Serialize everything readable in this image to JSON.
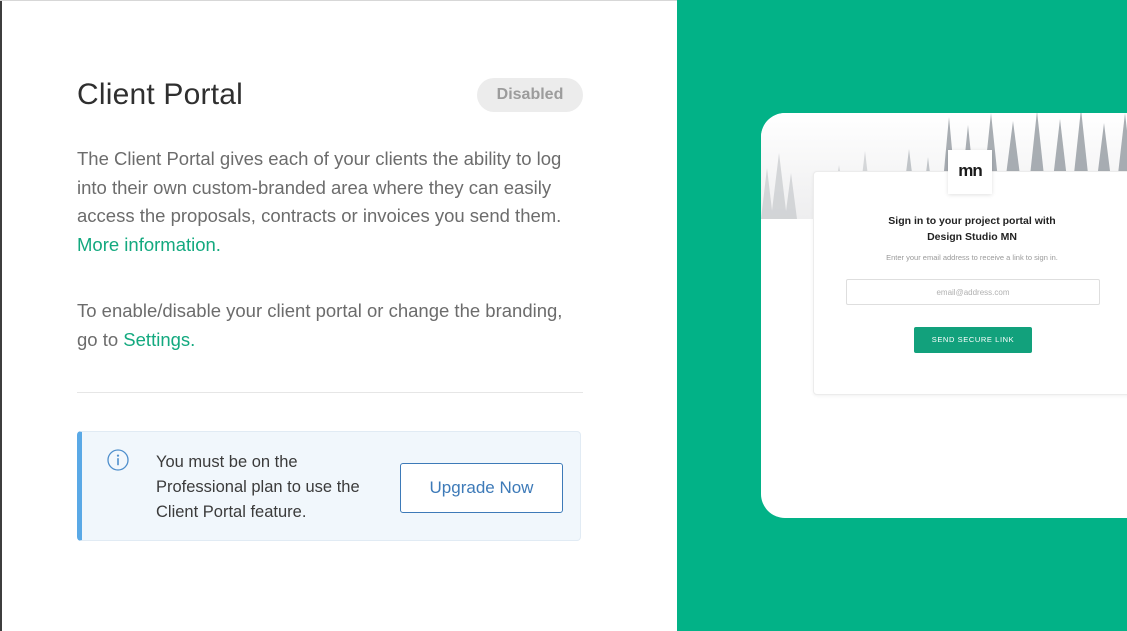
{
  "header": {
    "title": "Client Portal",
    "status_badge": "Disabled"
  },
  "description": {
    "text": "The Client Portal gives each of your clients the ability to log into their own custom-branded area where they can easily access the proposals, contracts or invoices you send them.",
    "more_link": "More information."
  },
  "settings_note": {
    "text": "To enable/disable your client portal or change the branding, go to",
    "settings_link": "Settings."
  },
  "notice": {
    "icon": "info-icon",
    "text": "You must be on the Professional plan to use the Client Portal feature.",
    "upgrade_label": "Upgrade Now"
  },
  "preview": {
    "logo": "mn",
    "signin_title_line1": "Sign in to your project portal with",
    "signin_title_line2": "Design Studio MN",
    "signin_subtitle": "Enter your email address to receive a link to sign in.",
    "email_placeholder": "email@address.com",
    "send_button": "SEND SECURE LINK"
  },
  "colors": {
    "accent_green": "#02b287",
    "link_green": "#13a97f",
    "upgrade_blue": "#3d7ab8",
    "notice_border": "#5aa9e6",
    "badge_bg": "#ececec"
  }
}
